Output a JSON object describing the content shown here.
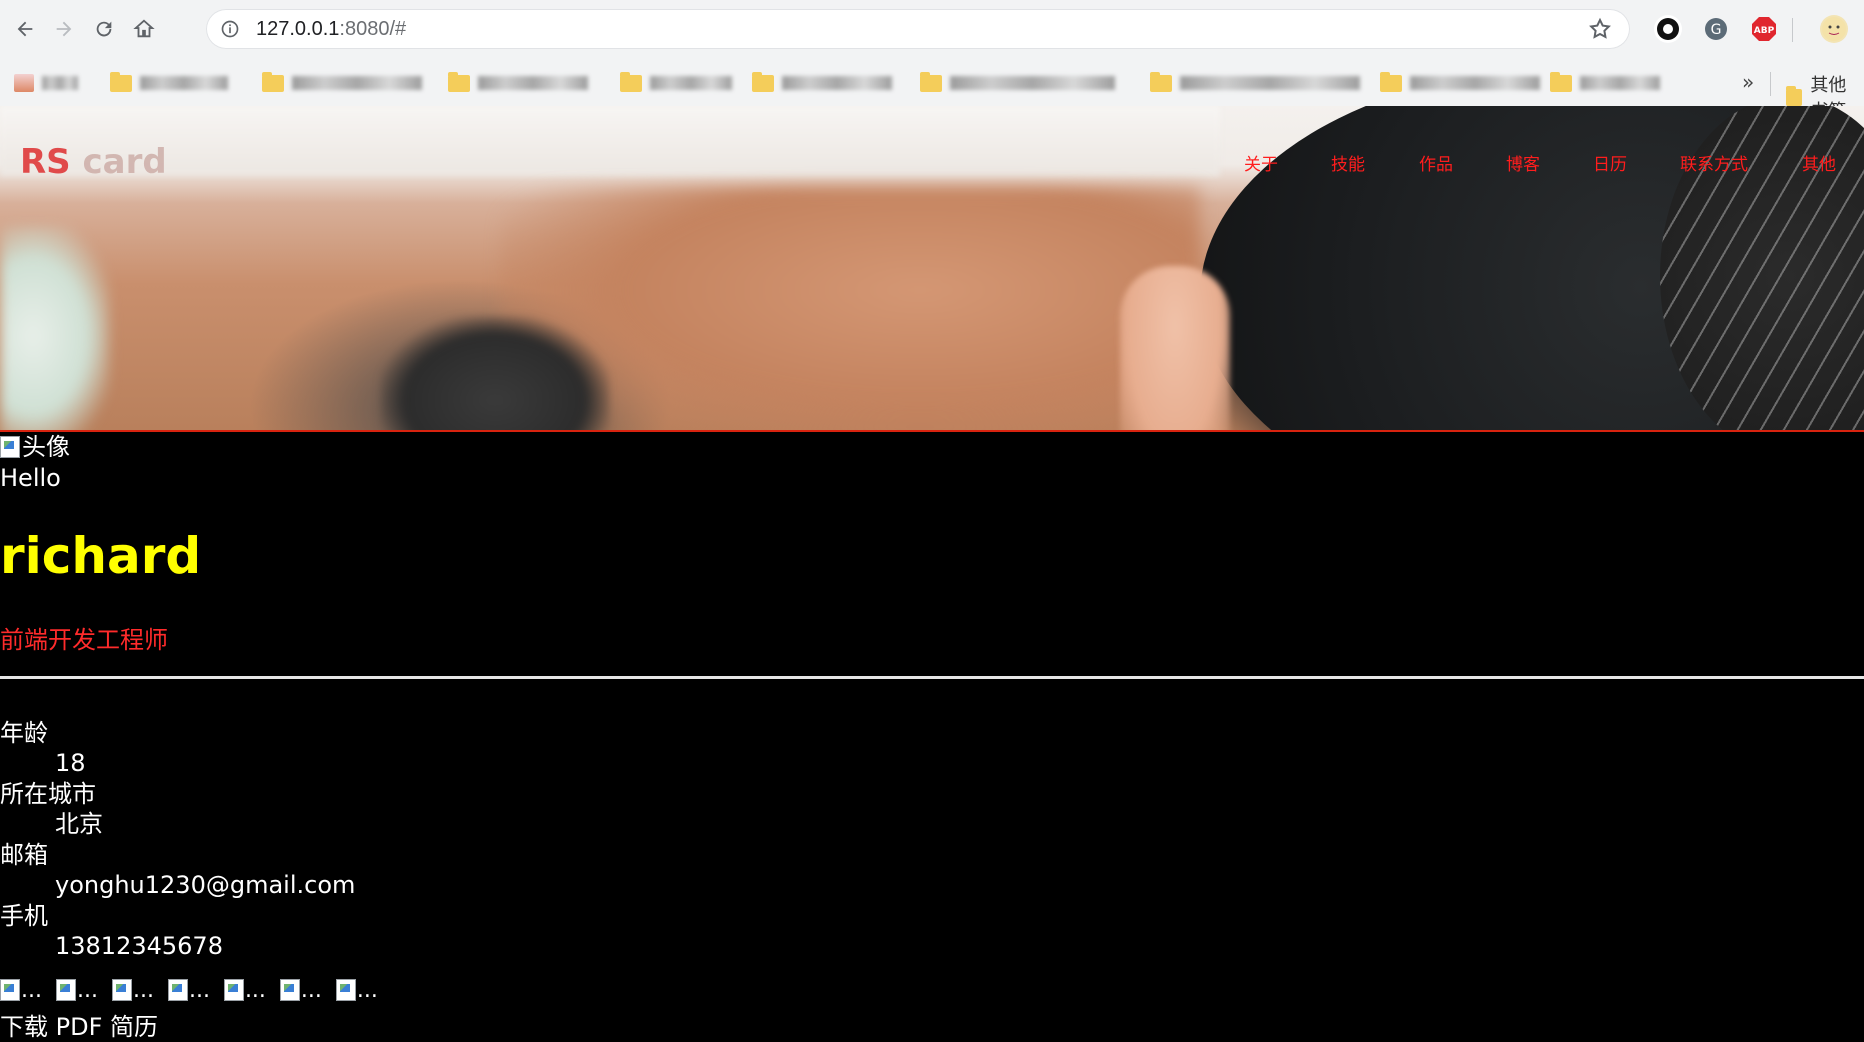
{
  "browser": {
    "url_host": "127.0.0.1",
    "url_path": ":8080/#",
    "bookmarks_overflow": "»",
    "other_bookmarks": "其他书签"
  },
  "site": {
    "logo_rs": "RS",
    "logo_card": "card",
    "nav": [
      "关于",
      "技能",
      "作品",
      "博客",
      "日历",
      "联系方式",
      "其他"
    ]
  },
  "profile": {
    "avatar_alt": "头像",
    "greeting": "Hello",
    "name": "richard",
    "title": "前端开发工程师",
    "info": [
      {
        "label": "年龄",
        "value": "18"
      },
      {
        "label": "所在城市",
        "value": "北京"
      },
      {
        "label": "邮箱",
        "value": "yonghu1230@gmail.com"
      },
      {
        "label": "手机",
        "value": "13812345678"
      }
    ],
    "social_alt": [
      "...",
      "...",
      "...",
      "...",
      "...",
      "...",
      "..."
    ],
    "download_label": "下载 PDF 简历"
  },
  "colors": {
    "name": "#ffff00",
    "title": "#ff2b2b",
    "nav": "#ff1d1d",
    "logo": "#e04a4a"
  }
}
